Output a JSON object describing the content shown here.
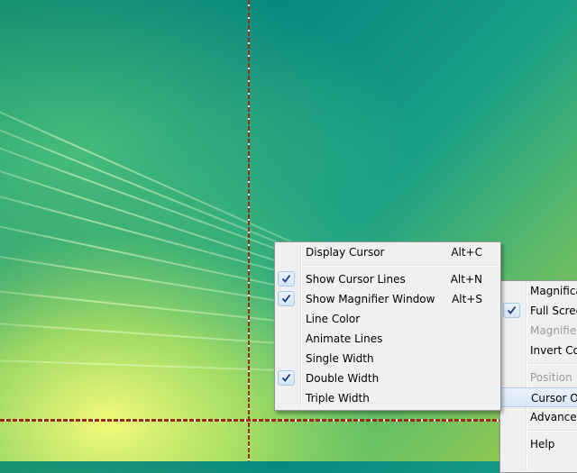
{
  "cursor_menu": {
    "items": [
      {
        "label": "Display Cursor",
        "shortcut": "Alt+C",
        "checked": false
      },
      {
        "type": "separator"
      },
      {
        "label": "Show Cursor Lines",
        "shortcut": "Alt+N",
        "checked": true
      },
      {
        "label": "Show Magnifier Window",
        "shortcut": "Alt+S",
        "checked": true
      },
      {
        "label": "Line Color",
        "shortcut": "",
        "checked": false
      },
      {
        "label": "Animate Lines",
        "shortcut": "",
        "checked": false
      },
      {
        "label": "Single Width",
        "shortcut": "",
        "checked": false
      },
      {
        "label": "Double Width",
        "shortcut": "",
        "checked": true
      },
      {
        "label": "Triple Width",
        "shortcut": "",
        "checked": false
      }
    ]
  },
  "main_menu": {
    "items": [
      {
        "label": "Magnifica",
        "checked": false,
        "disabled": false
      },
      {
        "label": "Full Screen",
        "checked": true,
        "disabled": false
      },
      {
        "label": "Magnifier",
        "checked": false,
        "disabled": true
      },
      {
        "label": "Invert Col",
        "checked": false,
        "disabled": false
      },
      {
        "type": "separator"
      },
      {
        "label": "Position",
        "checked": false,
        "disabled": true
      },
      {
        "label": "Cursor Op",
        "checked": false,
        "disabled": false,
        "highlighted": true
      },
      {
        "label": "Advanced",
        "checked": false,
        "disabled": false
      },
      {
        "type": "separator"
      },
      {
        "label": "Help",
        "checked": false,
        "disabled": false
      }
    ]
  },
  "colors": {
    "cursor_line": "#9d2a12",
    "menu_background": "#f0f0f0",
    "check_mark": "#1b3a8f"
  },
  "icons": {
    "check": "check-icon"
  }
}
